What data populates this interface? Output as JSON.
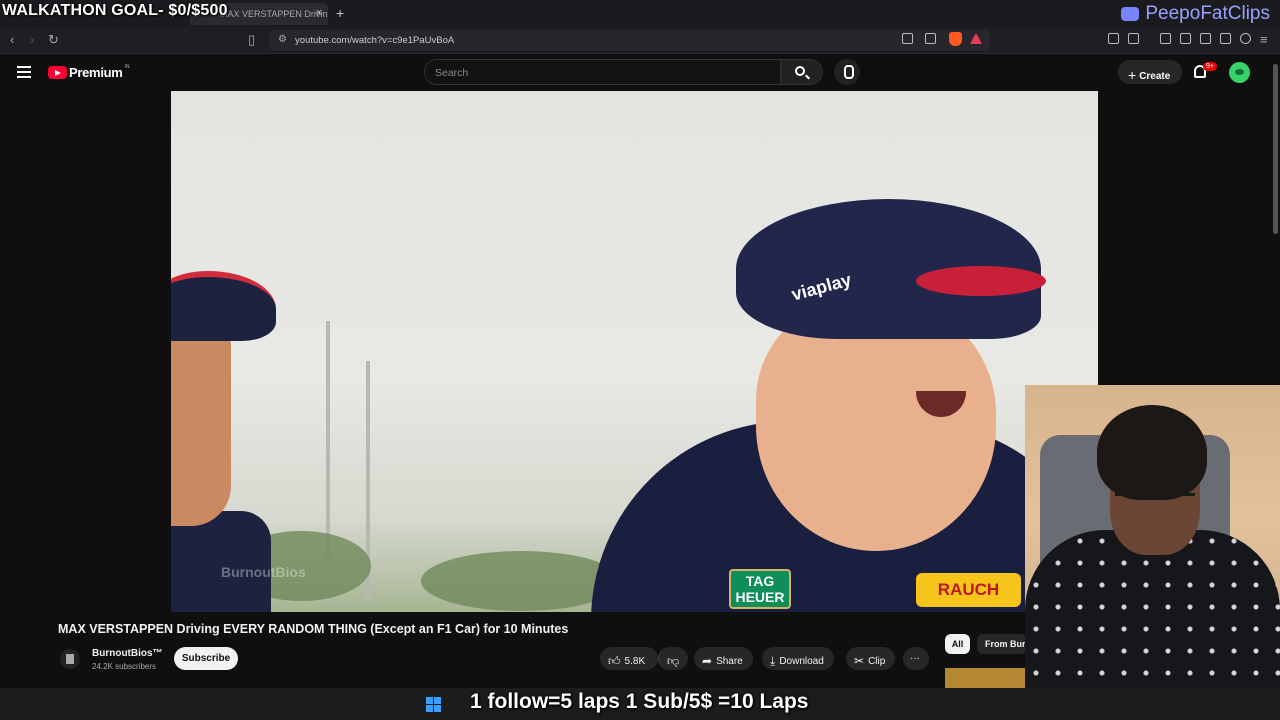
{
  "overlay": {
    "goal_text": "WALKATHON GOAL- $0/$500",
    "laps_text": "1 follow=5 laps 1 Sub/5$ =10 Laps",
    "discord_name": "PeepoFatClips"
  },
  "browser": {
    "tab_title": "MAX VERSTAPPEN Drivin",
    "url": "youtube.com/watch?v=c9e1PaUvBoA"
  },
  "header": {
    "logo_text": "Premium",
    "logo_region": "IN",
    "search_placeholder": "Search",
    "create_label": "Create",
    "notif_badge": "9+"
  },
  "video": {
    "watermark": "BurnoutBios",
    "cap_logo": "viaplay",
    "sponsor_tag": "TAG HEUER",
    "sponsor_rauch": "RAUCH",
    "title": "MAX VERSTAPPEN Driving EVERY RANDOM THING (Except an F1 Car) for 10 Minutes"
  },
  "channel": {
    "name": "BurnoutBios™",
    "subscribers": "24.2K subscribers",
    "subscribe_label": "Subscribe"
  },
  "actions": {
    "likes": "5.8K",
    "share": "Share",
    "download": "Download",
    "clip": "Clip",
    "more": "···"
  },
  "chips": {
    "all": "All",
    "from": "From Burn"
  }
}
